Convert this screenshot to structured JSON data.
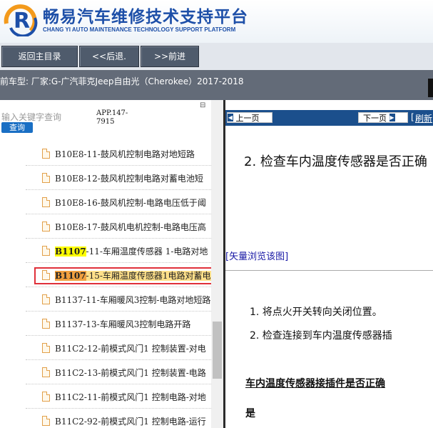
{
  "header": {
    "title_cn": "畅易汽车维修技术支持平台",
    "title_en": "CHANG YI AUTO MAINTENANCE TECHNOLOGY SUPPORT PLATFORM",
    "logo_letter": "R"
  },
  "toolbar": {
    "home_label": "返回主目录",
    "back_label": "<<后退.",
    "forward_label": ">>前进"
  },
  "vehicle": {
    "text": "前车型:   厂家:G-广汽菲克Jeep自由光（Cherokee）2017-2018"
  },
  "search": {
    "placeholder": "输入关键字查询",
    "button_label": "查询",
    "app_code": "APP.147-7915",
    "corner_mark": "⊟"
  },
  "tree": {
    "items": [
      {
        "code": "",
        "label": "B10E8-11-鼓风机控制电路对地短路"
      },
      {
        "code": "",
        "label": "B10E8-12-鼓风机控制电路对蓄电池短"
      },
      {
        "code": "",
        "label": "B10E8-16-鼓风机控制-电路电压低于阈"
      },
      {
        "code": "",
        "label": "B10E8-17-鼓风机电机控制-电路电压高"
      },
      {
        "code": "B1107",
        "label": "-11-车厢温度传感器 1-电路对地"
      },
      {
        "code": "B1107",
        "label": "-15-车厢温度传感器1电路对蓄电"
      },
      {
        "code": "",
        "label": "B1137-11-车厢暖风3控制-电路对地短路"
      },
      {
        "code": "",
        "label": "B1137-13-车厢暖风3控制电路开路"
      },
      {
        "code": "",
        "label": "B11C2-12-前模式风门1 控制装置-对电"
      },
      {
        "code": "",
        "label": "B11C2-13-前模式风门1 控制装置-电路"
      },
      {
        "code": "",
        "label": "B11C2-11-前模式风门1 控制电路-对地"
      },
      {
        "code": "",
        "label": "B11C2-92-前模式风门1 控制电路-运行"
      }
    ]
  },
  "viewer": {
    "prev_label": "上一页",
    "next_label": "下一页",
    "refresh_label": "刷新",
    "step_title": "2. 检查车内温度传感器是否正确",
    "vector_link": "[矢量浏览该图]",
    "step1": "1.  将点火开关转向关闭位置。",
    "step2": "2.  检查连接到车内温度传感器插",
    "question": "车内温度传感器接插件是否正确",
    "answer": "是"
  }
}
